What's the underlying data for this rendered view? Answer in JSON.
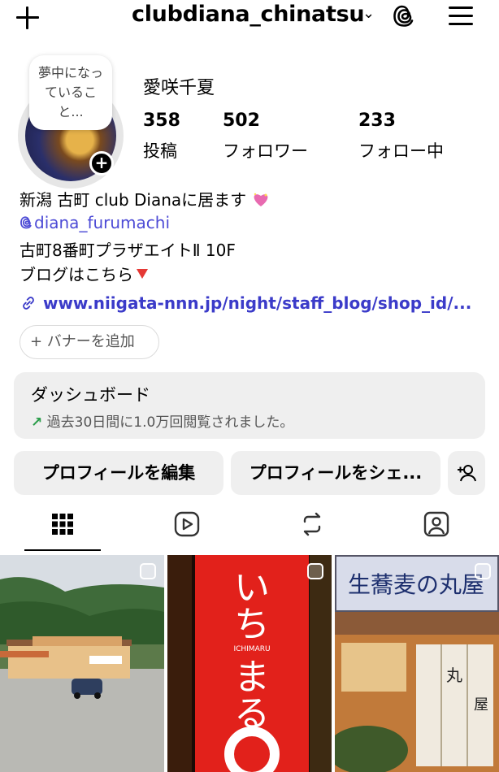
{
  "header": {
    "username": "clubdiana_chinatsu",
    "chevron": "⌄",
    "icons": [
      "plus-icon",
      "threads-icon",
      "menu-icon"
    ]
  },
  "profile": {
    "note": "夢中になっていること...",
    "display_name": "愛咲千夏",
    "stats": [
      {
        "value": "358",
        "label": "投稿"
      },
      {
        "value": "502",
        "label": "フォロワー"
      },
      {
        "value": "233",
        "label": "フォロー中"
      }
    ]
  },
  "bio": {
    "line1": "新潟 古町 club Dianaに居ます",
    "threads_handle": "diana_furumachi",
    "line3": "古町8番町プラザエイトⅡ 10F",
    "line4": "ブログはこちら",
    "link": "www.niigata-nnn.jp/night/staff_blog/shop_id/..."
  },
  "banner_button": "+ バナーを追加",
  "dashboard": {
    "title": "ダッシュボード",
    "arrow": "↗",
    "subtitle": "過去30日間に1.0万回閲覧されました。"
  },
  "actions": {
    "edit_profile": "プロフィールを編集",
    "share_profile": "プロフィールをシェ..."
  },
  "grid_images": [
    {
      "description": "roadside building with mountains",
      "icon": "multi-select"
    },
    {
      "description": "red lantern sign ICHIMARU",
      "text": "いち まる ICHIMARU"
    },
    {
      "description": "soba restaurant sign",
      "text": "生蕎麦の丸屋"
    }
  ],
  "colors": {
    "accent_link": "#3b3bc9",
    "button_bg": "#efefef",
    "dashboard_arrow": "#2a9d4a",
    "lantern_red": "#e2211b"
  }
}
